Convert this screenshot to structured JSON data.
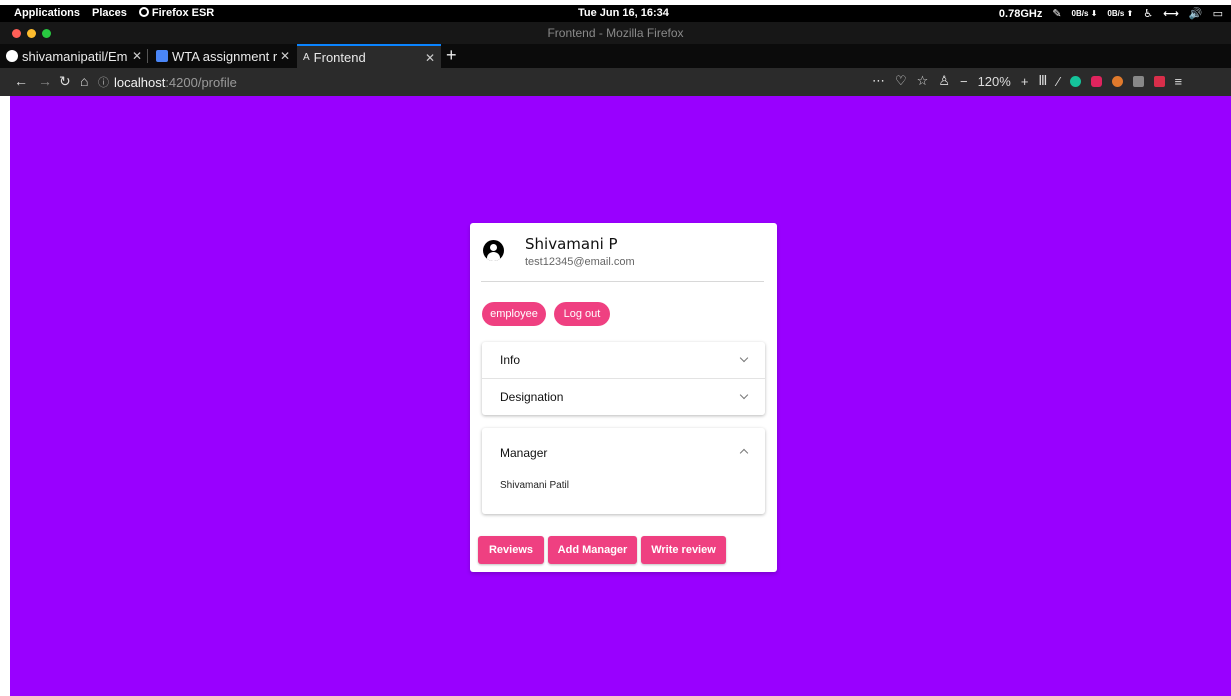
{
  "system_bar": {
    "applications": "Applications",
    "places": "Places",
    "app": "Firefox ESR",
    "datetime": "Tue Jun 16, 16:34",
    "cpu": "0.78GHz",
    "net_down": "0B/s",
    "net_up": "0B/s"
  },
  "window": {
    "title": "Frontend - Mozilla Firefox"
  },
  "tabs": [
    {
      "label": "shivamanipatil/Em"
    },
    {
      "label": "WTA assignment r"
    },
    {
      "label": "Frontend"
    }
  ],
  "navbar": {
    "url_host": "localhost",
    "url_path": ":4200/profile",
    "zoom": "120%"
  },
  "profile": {
    "name": "Shivamani P",
    "email": "test12345@email.com",
    "role_chip": "employee",
    "logout_chip": "Log out",
    "panels": [
      {
        "label": "Info",
        "expanded": false
      },
      {
        "label": "Designation",
        "expanded": false
      }
    ],
    "manager_panel": {
      "label": "Manager",
      "value": "Shivamani Patil",
      "expanded": true
    },
    "buttons": {
      "reviews": "Reviews",
      "add_manager": "Add Manager",
      "write_review": "Write review"
    }
  },
  "colors": {
    "page_bg": "#9900ff",
    "accent": "#ef4081"
  }
}
